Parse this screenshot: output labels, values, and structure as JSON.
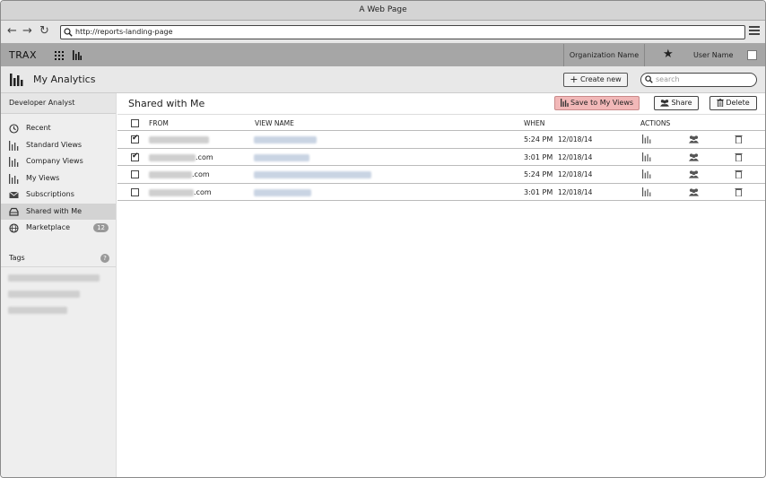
{
  "window": {
    "title": "A Web Page"
  },
  "browser": {
    "url": "http://reports-landing-page"
  },
  "appbar": {
    "brand": "TRAX",
    "organization": "Organization Name",
    "user": "User Name"
  },
  "subbar": {
    "title": "My Analytics",
    "create_label": "Create new",
    "search_placeholder": "search"
  },
  "sidebar": {
    "role": "Developer Analyst",
    "items": [
      {
        "label": "Recent",
        "icon": "clock-icon"
      },
      {
        "label": "Standard Views",
        "icon": "bar-chart-icon"
      },
      {
        "label": "Company Views",
        "icon": "bar-chart-icon"
      },
      {
        "label": "My Views",
        "icon": "bar-chart-icon"
      },
      {
        "label": "Subscriptions",
        "icon": "envelope-icon"
      },
      {
        "label": "Shared with Me",
        "icon": "inbox-icon"
      },
      {
        "label": "Marketplace",
        "icon": "globe-icon",
        "badge": "12"
      }
    ],
    "active_item": "Shared with Me",
    "tags": {
      "title": "Tags",
      "help": "?"
    }
  },
  "main": {
    "title": "Shared with Me",
    "buttons": {
      "save": "Save to My Views",
      "share": "Share",
      "delete": "Delete"
    },
    "columns": {
      "from": "FROM",
      "view": "VIEW NAME",
      "when": "WHEN",
      "actions": "ACTIONS"
    },
    "rows": [
      {
        "checked": true,
        "from_suffix": "",
        "time": "5:24 PM",
        "date": "12/018/14"
      },
      {
        "checked": true,
        "from_suffix": ".com",
        "time": "3:01 PM",
        "date": "12/018/14"
      },
      {
        "checked": false,
        "from_suffix": ".com",
        "time": "5:24 PM",
        "date": "12/018/14"
      },
      {
        "checked": false,
        "from_suffix": ".com",
        "time": "3:01 PM",
        "date": "12/018/14"
      }
    ]
  },
  "colors": {
    "save_button": "#f2b8b8",
    "appbar": "#a6a6a6",
    "sidebar_active": "#d3d3d3"
  }
}
